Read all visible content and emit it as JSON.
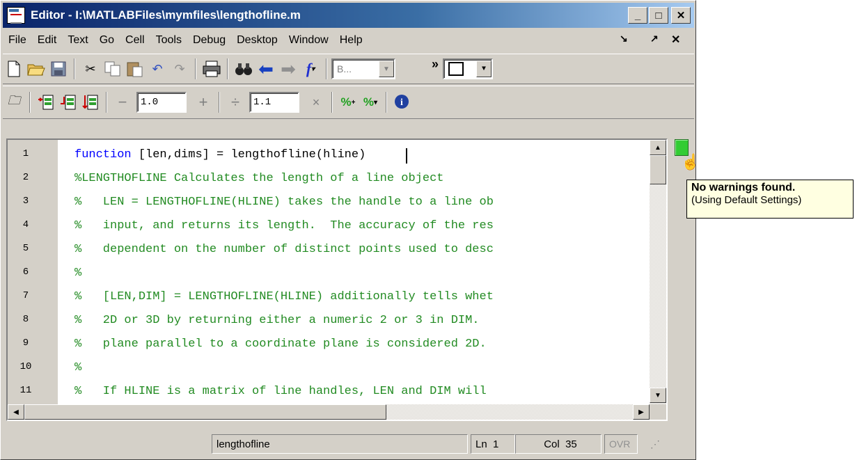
{
  "window": {
    "title": "Editor - I:\\MATLABFiles\\mymfiles\\lengthofline.m"
  },
  "menubar": {
    "items": [
      "File",
      "Edit",
      "Text",
      "Go",
      "Cell",
      "Tools",
      "Debug",
      "Desktop",
      "Window",
      "Help"
    ]
  },
  "toolbar1": {
    "icons": [
      "new-file",
      "open",
      "save",
      "cut",
      "copy",
      "paste",
      "undo",
      "redo",
      "print",
      "find",
      "back",
      "forward",
      "function",
      "stack"
    ],
    "stack_value": "B...",
    "layout_glyph": "»"
  },
  "toolbar2": {
    "minus_label": "−",
    "value1": "1.0",
    "plus_label": "+",
    "divide_label": "÷",
    "value2": "1.1",
    "times_label": "×"
  },
  "editor": {
    "line_numbers": [
      "1",
      "2",
      "3",
      "4",
      "5",
      "6",
      "7",
      "8",
      "9",
      "10",
      "11"
    ],
    "lines": [
      {
        "kw": "function",
        "text": " [len,dims] = lengthofline(hline)"
      },
      {
        "text": "%LENGTHOFLINE Calculates the length of a line object"
      },
      {
        "text": "%   LEN = LENGTHOFLINE(HLINE) takes the handle to a line ob"
      },
      {
        "text": "%   input, and returns its length.  The accuracy of the res"
      },
      {
        "text": "%   dependent on the number of distinct points used to desc"
      },
      {
        "text": "%"
      },
      {
        "text": "%   [LEN,DIM] = LENGTHOFLINE(HLINE) additionally tells whet"
      },
      {
        "text": "%   2D or 3D by returning either a numeric 2 or 3 in DIM."
      },
      {
        "text": "%   plane parallel to a coordinate plane is considered 2D."
      },
      {
        "text": "%"
      },
      {
        "text": "%   If HLINE is a matrix of line handles, LEN and DIM will"
      }
    ]
  },
  "colors": {
    "keyword": "#0000ff",
    "comment": "#228b22",
    "code": "#000000",
    "mlint_ok": "#33cc33",
    "tooltip_bg": "#ffffe1"
  },
  "tooltip": {
    "main": "No warnings found.",
    "sub": "(Using Default Settings)"
  },
  "statusbar": {
    "function_name": "lengthofline",
    "ln_label": "Ln",
    "ln_value": "1",
    "col_label": "Col",
    "col_value": "35",
    "ovr": "OVR"
  }
}
